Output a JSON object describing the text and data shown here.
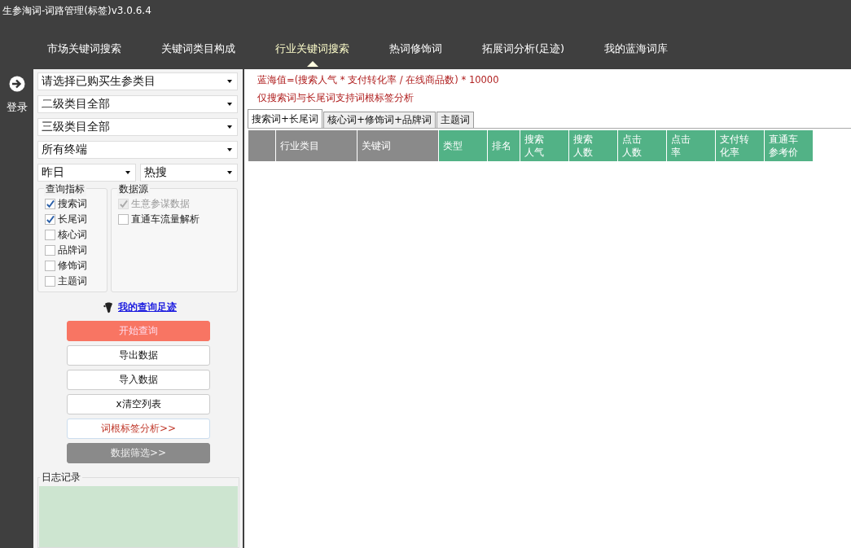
{
  "window": {
    "title": "生参淘词-词路管理(标签)v3.0.6.4"
  },
  "nav": [
    {
      "label": "市场关键词搜索",
      "selected": false
    },
    {
      "label": "关键词类目构成",
      "selected": false
    },
    {
      "label": "行业关键词搜索",
      "selected": true
    },
    {
      "label": "热词修饰词",
      "selected": false
    },
    {
      "label": "拓展词分析(足迹)",
      "selected": false
    },
    {
      "label": "我的蓝海词库",
      "selected": false
    }
  ],
  "login": {
    "label": "登录"
  },
  "selects": [
    {
      "value": "请选择已购买生参类目"
    },
    {
      "value": "二级类目全部"
    },
    {
      "value": "三级类目全部"
    },
    {
      "value": "所有终端"
    }
  ],
  "half_selects": [
    {
      "value": "昨日"
    },
    {
      "value": "热搜"
    }
  ],
  "indicators": {
    "title": "查询指标",
    "items": [
      {
        "label": "搜索词",
        "checked": true
      },
      {
        "label": "长尾词",
        "checked": true
      },
      {
        "label": "核心词",
        "checked": false
      },
      {
        "label": "品牌词",
        "checked": false
      },
      {
        "label": "修饰词",
        "checked": false
      },
      {
        "label": "主题词",
        "checked": false
      }
    ]
  },
  "sources": {
    "title": "数据源",
    "items": [
      {
        "label": "生意参谋数据",
        "checked": true,
        "disabled": true
      },
      {
        "label": "直通车流量解析",
        "checked": false,
        "disabled": false
      }
    ]
  },
  "footprint_link": "我的查询足迹",
  "buttons": [
    {
      "label": "开始查询",
      "kind": "primary"
    },
    {
      "label": "导出数据",
      "kind": "plain"
    },
    {
      "label": "导入数据",
      "kind": "plain"
    },
    {
      "label": "x清空列表",
      "kind": "plain"
    },
    {
      "label": "词根标签分析>>",
      "kind": "accent"
    },
    {
      "label": "数据筛选>>",
      "kind": "muted"
    }
  ],
  "log": {
    "title": "日志记录"
  },
  "notes": [
    "蓝海值=(搜索人气 * 支付转化率 / 在线商品数) * 10000",
    "仅搜索词与长尾词支持词根标签分析"
  ],
  "tabs": [
    {
      "label": "搜索词+长尾词",
      "selected": true
    },
    {
      "label": "核心词+修饰词+品牌词",
      "selected": false
    },
    {
      "label": "主题词",
      "selected": false
    }
  ],
  "table": {
    "columns": [
      {
        "color": "#8a8a8a"
      },
      {
        "label": "行业类目",
        "color": "#8a8a8a"
      },
      {
        "label": "关键词",
        "color": "#8a8a8a"
      },
      {
        "label": "类型",
        "color": "#52b286"
      },
      {
        "label": "排名",
        "color": "#52b286"
      },
      {
        "label": "搜索人气",
        "color": "#52b286"
      },
      {
        "label": "搜索人数",
        "color": "#52b286"
      },
      {
        "label": "点击人数",
        "color": "#52b286"
      },
      {
        "label": "点击率",
        "color": "#52b286"
      },
      {
        "label": "支付转化率",
        "color": "#52b286"
      },
      {
        "label": "直通车参考价",
        "color": "#52b286"
      }
    ]
  }
}
